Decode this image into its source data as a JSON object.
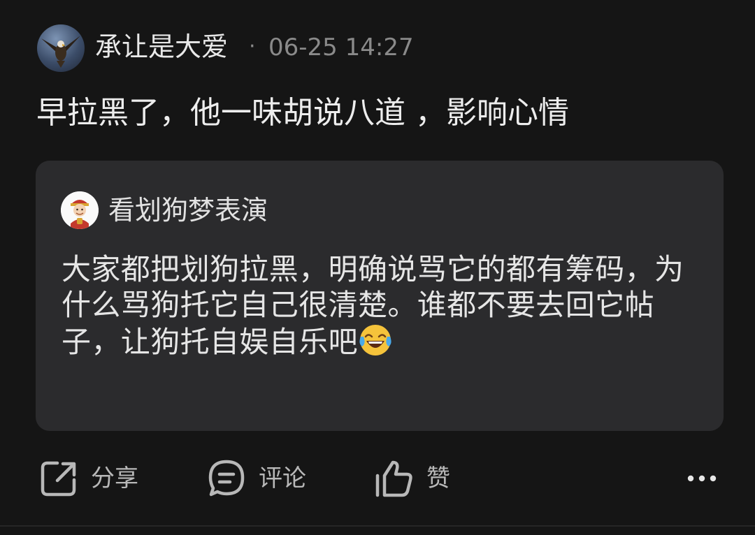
{
  "post": {
    "author_name": "承让是大爱",
    "separator": "·",
    "timestamp": "06-25 14:27",
    "avatar_icon": "eagle-avatar",
    "comment_text": "早拉黑了，他一味胡说八道 ，影响心情"
  },
  "quoted": {
    "author_name": "看划狗梦表演",
    "avatar_icon": "fortune-god-avatar",
    "text": "大家都把划狗拉黑，明确说骂它的都有筹码，为什么骂狗托它自己很清楚。谁都不要去回它帖子，让狗托自娱自乐吧",
    "emoji": "tears-of-joy-emoji"
  },
  "actions": {
    "share_label": "分享",
    "comment_label": "评论",
    "like_label": "赞",
    "share_icon": "share-icon",
    "comment_icon": "comment-icon",
    "like_icon": "thumbs-up-icon",
    "more_icon": "more-icon"
  },
  "colors": {
    "background": "#151515",
    "card_background": "#2b2b2d",
    "primary_text": "#ededed",
    "secondary_text": "#8a8a8a"
  }
}
